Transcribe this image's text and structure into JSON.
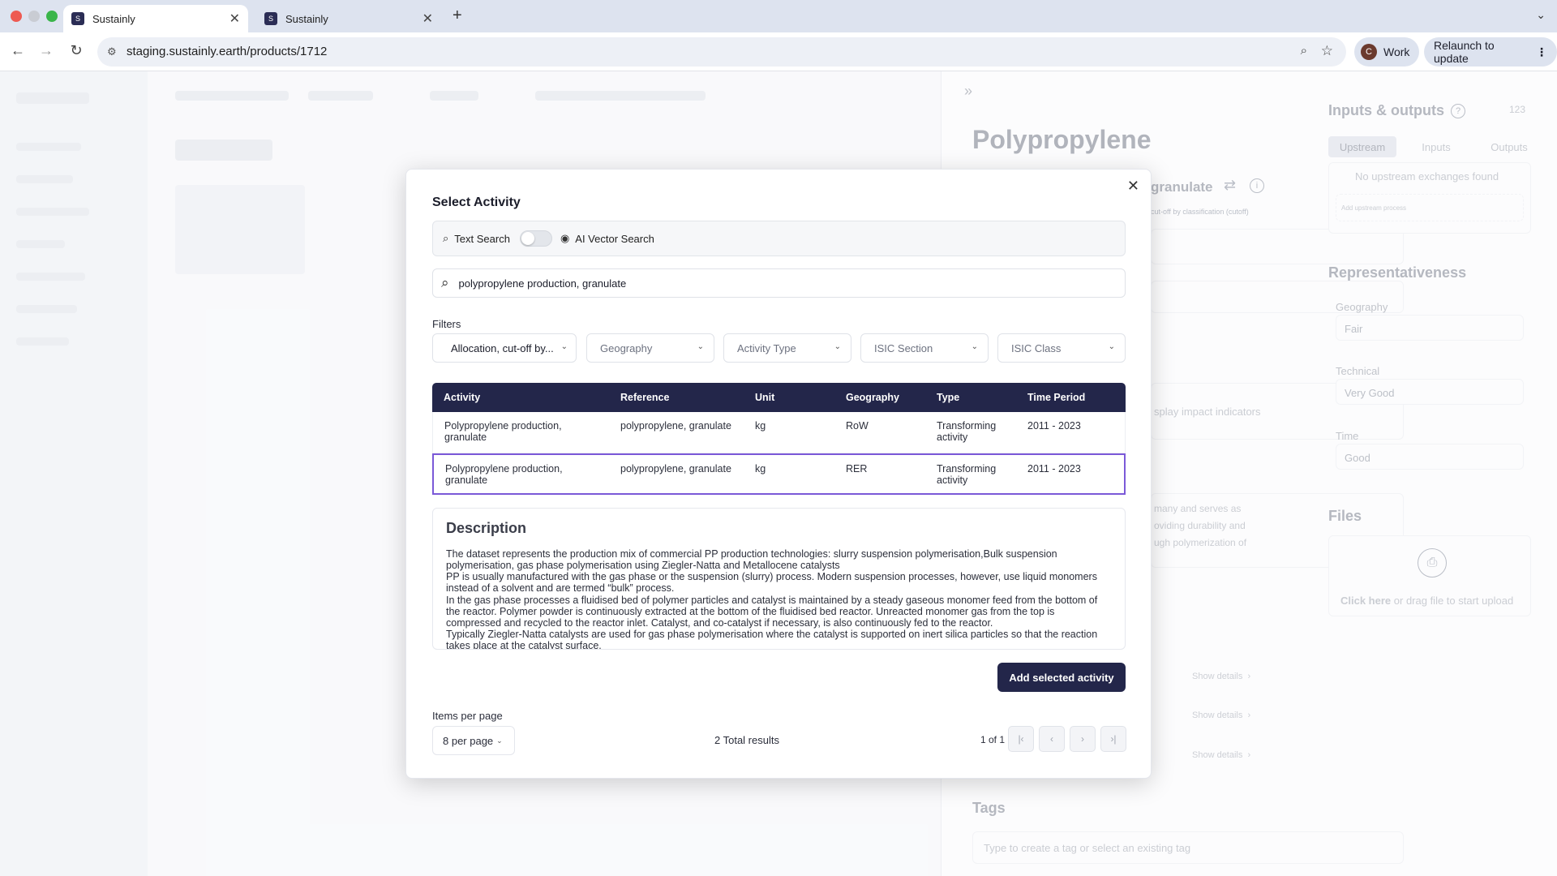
{
  "browser": {
    "tabs": [
      {
        "title": "Sustainly",
        "favicon": "S",
        "active": true
      },
      {
        "title": "Sustainly",
        "favicon": "S",
        "active": false
      }
    ],
    "url": "staging.sustainly.earth/products/1712",
    "profile": {
      "initial": "C",
      "label": "Work"
    },
    "relaunch_label": "Relaunch to update"
  },
  "background": {
    "product_title": "Polypropylene",
    "reference_fragment": "granulate",
    "reference_sub": "cut-off by classification (cutoff)",
    "impact_hint": "splay impact indicators",
    "desc_fragments": [
      "many and serves as",
      "oviding durability and",
      "ugh polymerization of"
    ],
    "show_details": [
      "Show details",
      "Show details",
      "Show details"
    ],
    "tags_heading": "Tags",
    "tags_placeholder": "Type to create a tag or select an existing tag",
    "io": {
      "heading": "Inputs & outputs",
      "count": "123",
      "tabs": [
        "Upstream",
        "Inputs",
        "Outputs"
      ],
      "empty": "No upstream exchanges found",
      "add": "Add upstream process"
    },
    "representativeness": {
      "heading": "Representativeness",
      "geography_label": "Geography",
      "geography_value": "Fair",
      "technical_label": "Technical",
      "technical_value": "Very Good",
      "time_label": "Time",
      "time_value": "Good"
    },
    "files": {
      "heading": "Files",
      "click": "Click here",
      "rest": " or drag file to start upload"
    }
  },
  "modal": {
    "title": "Select Activity",
    "mode": {
      "text_search": "Text Search",
      "ai_search": "AI Vector Search",
      "ai_enabled": false
    },
    "search_value": "polypropylene production, granulate",
    "filters_label": "Filters",
    "filters": [
      {
        "label": "Allocation, cut-off by...",
        "selected": true
      },
      {
        "label": "Geography",
        "selected": false
      },
      {
        "label": "Activity Type",
        "selected": false
      },
      {
        "label": "ISIC Section",
        "selected": false
      },
      {
        "label": "ISIC Class",
        "selected": false
      }
    ],
    "columns": [
      "Activity",
      "Reference",
      "Unit",
      "Geography",
      "Type",
      "Time Period"
    ],
    "rows": [
      {
        "activity": "Polypropylene production, granulate",
        "reference": "polypropylene, granulate",
        "unit": "kg",
        "geography": "RoW",
        "type": "Transforming activity",
        "period": "2011 - 2023",
        "selected": false
      },
      {
        "activity": "Polypropylene production, granulate",
        "reference": "polypropylene, granulate",
        "unit": "kg",
        "geography": "RER",
        "type": "Transforming activity",
        "period": "2011 - 2023",
        "selected": true
      }
    ],
    "description": {
      "heading": "Description",
      "text": "The dataset represents the production mix of commercial PP production technologies: slurry suspension polymerisation,Bulk suspension polymerisation, gas phase polymerisation using Ziegler-Natta and Metallocene catalysts\nPP is usually manufactured with the gas phase or the suspension (slurry) process. Modern suspension processes, however, use liquid monomers instead of a solvent and are termed “bulk” process.\nIn the gas phase processes a fluidised bed of polymer particles and catalyst is maintained by a steady gaseous monomer feed from the bottom of the reactor. Polymer powder is continuously extracted at the bottom of the fluidised bed reactor. Unreacted monomer gas from the top is compressed and recycled to the reactor inlet. Catalyst, and co-catalyst if necessary, is also continuously fed to the reactor.\nTypically Ziegler-Natta catalysts are used for gas phase polymerisation where the catalyst is supported on inert silica particles so that the reaction takes place at the catalyst surface."
    },
    "add_button": "Add selected activity",
    "items_per_page_label": "Items per page",
    "items_per_page_value": "8 per page",
    "total_results": "2 Total results",
    "page_info": "1 of 1"
  }
}
